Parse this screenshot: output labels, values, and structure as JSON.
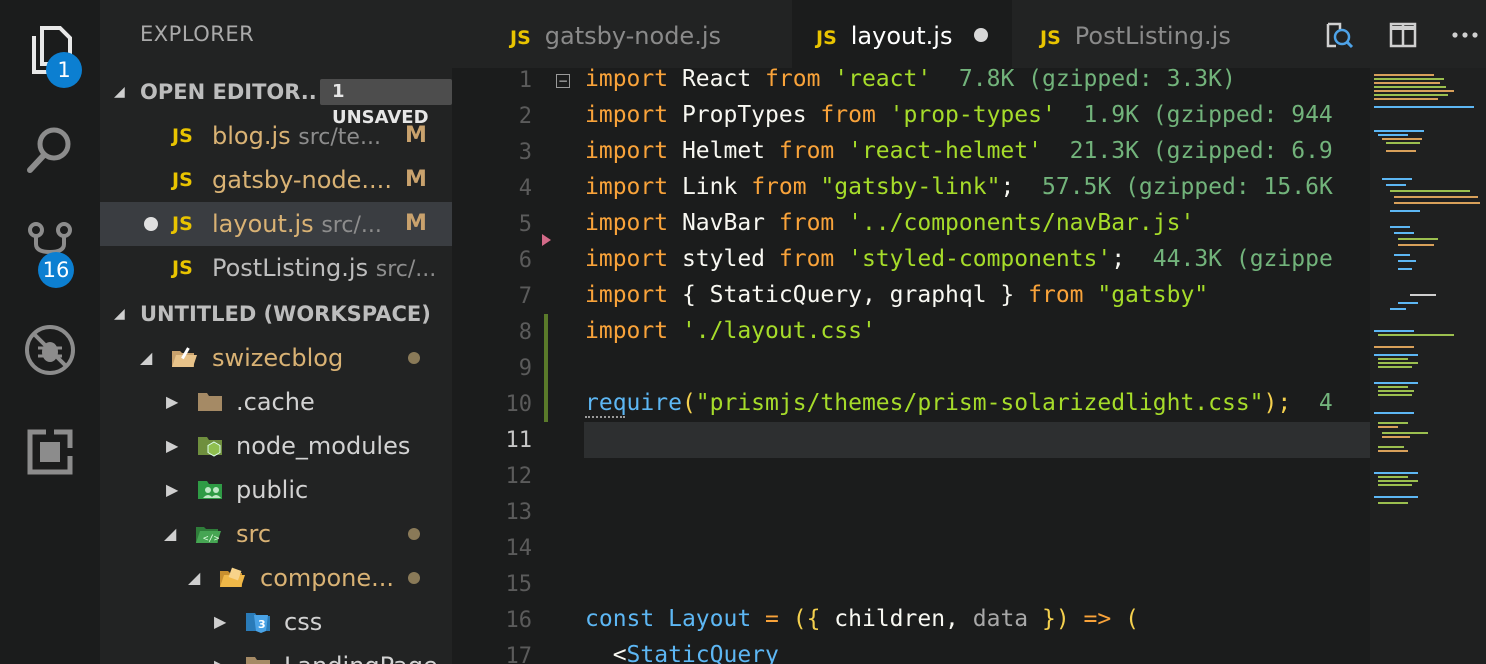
{
  "activity_bar": {
    "explorer_badge": "1",
    "scm_badge": "16"
  },
  "sidebar": {
    "title": "EXPLORER",
    "open_editors": {
      "label": "OPEN EDITOR..",
      "badge": "1 UNSAVED",
      "items": [
        {
          "icon": "JS",
          "name": "blog.js",
          "path": "src/te...",
          "status": "M",
          "active": false,
          "unsaved": false
        },
        {
          "icon": "JS",
          "name": "gatsby-node....",
          "path": "",
          "status": "M",
          "active": false,
          "unsaved": false
        },
        {
          "icon": "JS",
          "name": "layout.js",
          "path": "src/...",
          "status": "M",
          "active": true,
          "unsaved": true
        },
        {
          "icon": "JS",
          "name": "PostListing.js",
          "path": "src/...",
          "status": "",
          "active": false,
          "unsaved": false
        }
      ]
    },
    "workspace": {
      "label": "UNTITLED (WORKSPACE)",
      "tree": [
        {
          "name": "swizecblog",
          "expanded": true
        },
        {
          "name": ".cache",
          "expanded": false
        },
        {
          "name": "node_modules",
          "expanded": false
        },
        {
          "name": "public",
          "expanded": false
        },
        {
          "name": "src",
          "expanded": true
        },
        {
          "name": "compone...",
          "expanded": true
        },
        {
          "name": "css",
          "expanded": false
        },
        {
          "name": "LandingPage",
          "expanded": false
        }
      ]
    }
  },
  "tabs": [
    {
      "icon": "JS",
      "label": "gatsby-node.js",
      "active": false
    },
    {
      "icon": "JS",
      "label": "layout.js",
      "active": true,
      "dirty": true
    },
    {
      "icon": "JS",
      "label": "PostListing.js",
      "active": false
    }
  ],
  "editor": {
    "line_numbers": [
      "1",
      "2",
      "3",
      "4",
      "5",
      "6",
      "7",
      "8",
      "9",
      "10",
      "11",
      "12",
      "13",
      "14",
      "15",
      "16",
      "17"
    ],
    "current_line": "11",
    "lines": {
      "l1": {
        "kw1": "import",
        "id": " React ",
        "kw2": "from",
        "str": " 'react'",
        "cost": "  7.8K (gzipped: 3.3K)"
      },
      "l2": {
        "kw1": "import",
        "id": " PropTypes ",
        "kw2": "from",
        "str": " 'prop-types'",
        "cost": "  1.9K (gzipped: 944"
      },
      "l3": {
        "kw1": "import",
        "id": " Helmet ",
        "kw2": "from",
        "str": " 'react-helmet'",
        "cost": "  21.3K (gzipped: 6.9"
      },
      "l4": {
        "kw1": "import",
        "id": " Link ",
        "kw2": "from",
        "str": " \"gatsby-link\"",
        "punc": ";",
        "cost": "  57.5K (gzipped: 15.6K"
      },
      "l5": {
        "kw1": "import",
        "id": " NavBar ",
        "kw2": "from",
        "str": " '../components/navBar.js'"
      },
      "l6": {
        "kw1": "import",
        "id": " styled ",
        "kw2": "from",
        "str": " 'styled-components'",
        "punc": ";",
        "cost": "  44.3K (gzippe"
      },
      "l7": {
        "kw1": "import",
        "id": " { StaticQuery, graphql } ",
        "kw2": "from",
        "str": " \"gatsby\""
      },
      "l8": {
        "kw1": "import",
        "str": " './layout.css'"
      },
      "l10": {
        "fn": "require",
        "punc1": "(",
        "str": "\"prismjs/themes/prism-solarizedlight.css\"",
        "punc2": ");",
        "cost": "  4"
      },
      "l16": {
        "kw1": "const",
        "fn": " Layout",
        "punc1": " = ",
        "brk1": "({",
        "id": " children, ",
        "arg": "data",
        "brk2": " })",
        "arrow": " => ",
        "brk3": "("
      },
      "l17": {
        "punc": "  <",
        "tag": "StaticQuery"
      }
    }
  }
}
